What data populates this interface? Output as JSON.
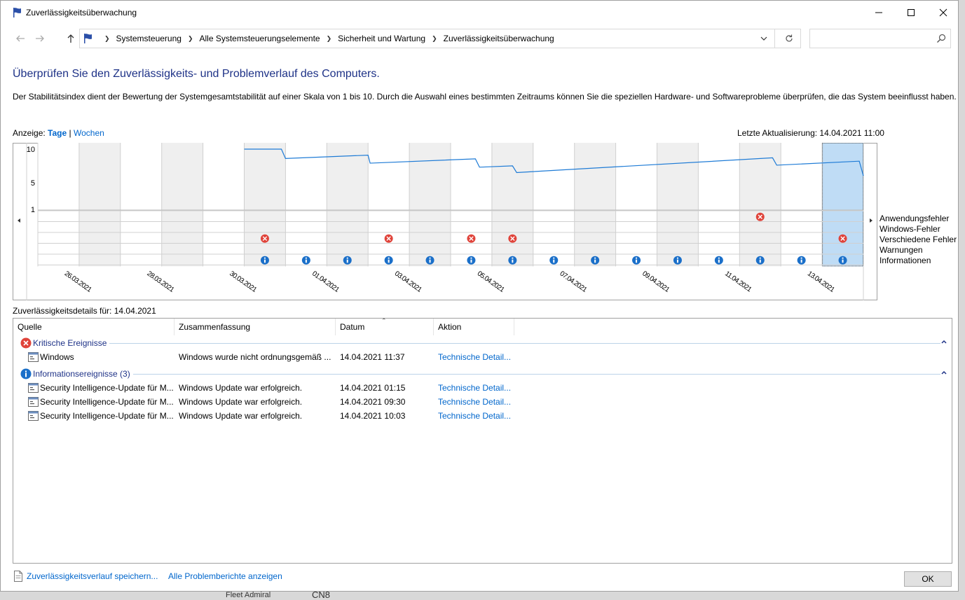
{
  "window": {
    "title": "Zuverlässigkeitsüberwachung"
  },
  "address": {
    "crumbs": [
      "Systemsteuerung",
      "Alle Systemsteuerungselemente",
      "Sicherheit und Wartung",
      "Zuverlässigkeitsüberwachung"
    ],
    "search_placeholder": ""
  },
  "page": {
    "heading": "Überprüfen Sie den Zuverlässigkeits- und Problemverlauf des Computers.",
    "description": "Der Stabilitätsindex dient der Bewertung der Systemgesamtstabilität auf einer Skala von 1 bis 10. Durch die Auswahl eines bestimmten Zeitraums können Sie die speziellen Hardware- und Softwareprobleme überprüfen, die das System beeinflusst haben.",
    "view_label": "Anzeige:",
    "view_days": "Tage",
    "view_sep": "|",
    "view_weeks": "Wochen",
    "last_update": "Letzte Aktualisierung: 14.04.2021 11:00",
    "details_label": "Zuverlässigkeitsdetails für: 14.04.2021"
  },
  "chart_data": {
    "type": "line",
    "yticks": [
      "10",
      "5",
      "1"
    ],
    "ylim": [
      1,
      10
    ],
    "columns": 20,
    "selected_column": 19,
    "date_labels": [
      "26.03.2021",
      "28.03.2021",
      "30.03.2021",
      "01.04.2021",
      "03.04.2021",
      "05.04.2021",
      "07.04.2021",
      "09.04.2021",
      "11.04.2021",
      "13.04.2021"
    ],
    "stability_index": [
      {
        "col": 5.0,
        "v": 10.0
      },
      {
        "col": 5.9,
        "v": 10.0
      },
      {
        "col": 6.0,
        "v": 8.6
      },
      {
        "col": 8.0,
        "v": 9.1
      },
      {
        "col": 8.05,
        "v": 7.9
      },
      {
        "col": 10.6,
        "v": 8.55
      },
      {
        "col": 10.7,
        "v": 7.3
      },
      {
        "col": 11.5,
        "v": 7.5
      },
      {
        "col": 11.6,
        "v": 6.5
      },
      {
        "col": 17.8,
        "v": 8.7
      },
      {
        "col": 17.9,
        "v": 7.6
      },
      {
        "col": 19.9,
        "v": 8.2
      },
      {
        "col": 20.0,
        "v": 6.0
      }
    ],
    "event_rows": [
      "Anwendungsfehler",
      "Windows-Fehler",
      "Verschiedene Fehler",
      "Warnungen",
      "Informationen"
    ],
    "events": {
      "Anwendungsfehler": [
        17
      ],
      "Windows-Fehler": [],
      "Verschiedene Fehler": [
        5,
        8,
        10,
        11,
        19
      ],
      "Warnungen": [],
      "Informationen": [
        5,
        6,
        7,
        8,
        9,
        10,
        11,
        12,
        13,
        14,
        15,
        16,
        17,
        18,
        19
      ]
    }
  },
  "table": {
    "columns": [
      "Quelle",
      "Zusammenfassung",
      "Datum",
      "Aktion"
    ],
    "groups": [
      {
        "label": "Kritische Ereignisse",
        "kind": "error",
        "rows": [
          {
            "source": "Windows",
            "summary": "Windows wurde nicht ordnungsgemäß ...",
            "date": "14.04.2021 11:37",
            "action": "Technische Detail..."
          }
        ]
      },
      {
        "label": "Informationsereignisse (3)",
        "kind": "info",
        "rows": [
          {
            "source": "Security Intelligence-Update für M...",
            "summary": "Windows Update war erfolgreich.",
            "date": "14.04.2021 01:15",
            "action": "Technische Detail..."
          },
          {
            "source": "Security Intelligence-Update für M...",
            "summary": "Windows Update war erfolgreich.",
            "date": "14.04.2021 09:30",
            "action": "Technische Detail..."
          },
          {
            "source": "Security Intelligence-Update für M...",
            "summary": "Windows Update war erfolgreich.",
            "date": "14.04.2021 10:03",
            "action": "Technische Detail..."
          }
        ]
      }
    ]
  },
  "footer": {
    "save_link": "Zuverlässigkeitsverlauf speichern...",
    "reports_link": "Alle Problemberichte anzeigen",
    "ok": "OK"
  },
  "background": {
    "text1": "Fleet Admiral",
    "text2": "CN8"
  },
  "colors": {
    "accent": "#0066cc",
    "heading": "#1e3287",
    "line": "#1e7bd6",
    "selected": "#bfdcf5",
    "error": "#e0433a",
    "info": "#1a6fc9"
  }
}
